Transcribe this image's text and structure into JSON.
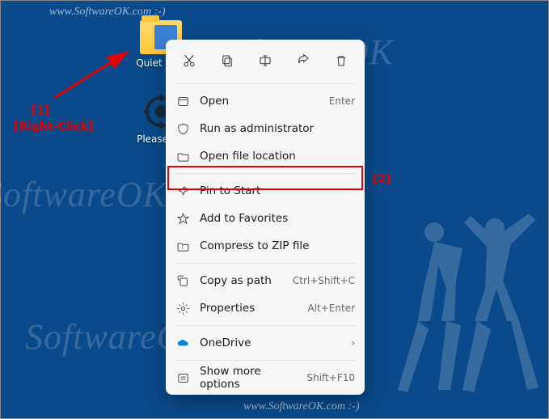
{
  "watermark": {
    "large": "SoftwareOK",
    "small": "www.SoftwareOK.com :-)"
  },
  "desktop": {
    "icons": [
      {
        "label": "Quiet Plea"
      },
      {
        "label": "Please Qu"
      }
    ]
  },
  "annotations": {
    "n1": "[1]",
    "rc": "[Right-Click]",
    "n2": "[2]"
  },
  "context_menu": {
    "top_icons": [
      "cut-icon",
      "copy-icon",
      "rename-icon",
      "share-icon",
      "delete-icon"
    ],
    "items": [
      {
        "icon": "open-icon",
        "label": "Open",
        "accel": "Enter"
      },
      {
        "icon": "admin-icon",
        "label": "Run as administrator",
        "accel": ""
      },
      {
        "icon": "folder-icon",
        "label": "Open file location",
        "accel": ""
      },
      {
        "icon": "pin-icon",
        "label": "Pin to Start",
        "accel": ""
      },
      {
        "icon": "star-icon",
        "label": "Add to Favorites",
        "accel": ""
      },
      {
        "icon": "zip-icon",
        "label": "Compress to ZIP file",
        "accel": ""
      },
      {
        "icon": "copypath-icon",
        "label": "Copy as path",
        "accel": "Ctrl+Shift+C"
      },
      {
        "icon": "props-icon",
        "label": "Properties",
        "accel": "Alt+Enter"
      },
      {
        "icon": "onedrive-icon",
        "label": "OneDrive",
        "accel": "",
        "submenu": true
      },
      {
        "icon": "more-icon",
        "label": "Show more options",
        "accel": "Shift+F10"
      }
    ]
  }
}
